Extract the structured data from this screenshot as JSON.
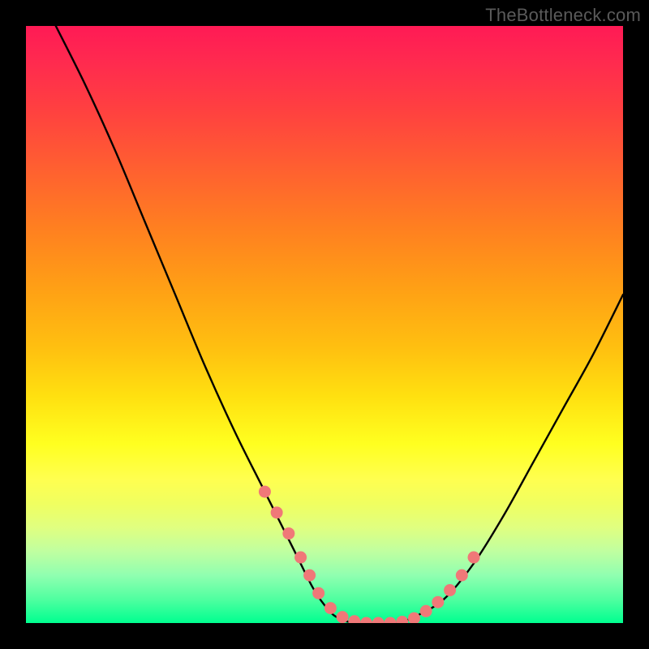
{
  "watermark": "TheBottleneck.com",
  "chart_data": {
    "type": "line",
    "title": "",
    "xlabel": "",
    "ylabel": "",
    "xlim": [
      0,
      100
    ],
    "ylim": [
      0,
      100
    ],
    "series": [
      {
        "name": "bottleneck-curve",
        "x": [
          5,
          10,
          15,
          20,
          25,
          30,
          35,
          40,
          45,
          48,
          50,
          52,
          55,
          58,
          60,
          62,
          65,
          70,
          75,
          80,
          85,
          90,
          95,
          100
        ],
        "values": [
          100,
          90,
          79,
          67,
          55,
          43,
          32,
          22,
          12,
          6,
          3,
          1,
          0,
          0,
          0,
          0,
          1,
          4,
          10,
          18,
          27,
          36,
          45,
          55
        ]
      }
    ],
    "markers": {
      "name": "sample-points",
      "color": "#f07878",
      "x": [
        40,
        42,
        44,
        46,
        47.5,
        49,
        51,
        53,
        55,
        57,
        59,
        61,
        63,
        65,
        67,
        69,
        71,
        73,
        75
      ],
      "values": [
        22,
        18.5,
        15,
        11,
        8,
        5,
        2.5,
        1,
        0.3,
        0,
        0,
        0,
        0.2,
        0.8,
        2,
        3.5,
        5.5,
        8,
        11
      ]
    },
    "gradient_stops": [
      {
        "pos": 0,
        "color": "#ff1a55"
      },
      {
        "pos": 14,
        "color": "#ff4040"
      },
      {
        "pos": 34,
        "color": "#ff8020"
      },
      {
        "pos": 54,
        "color": "#ffc010"
      },
      {
        "pos": 70,
        "color": "#ffff20"
      },
      {
        "pos": 88,
        "color": "#c0ffa0"
      },
      {
        "pos": 100,
        "color": "#00ff90"
      }
    ]
  }
}
